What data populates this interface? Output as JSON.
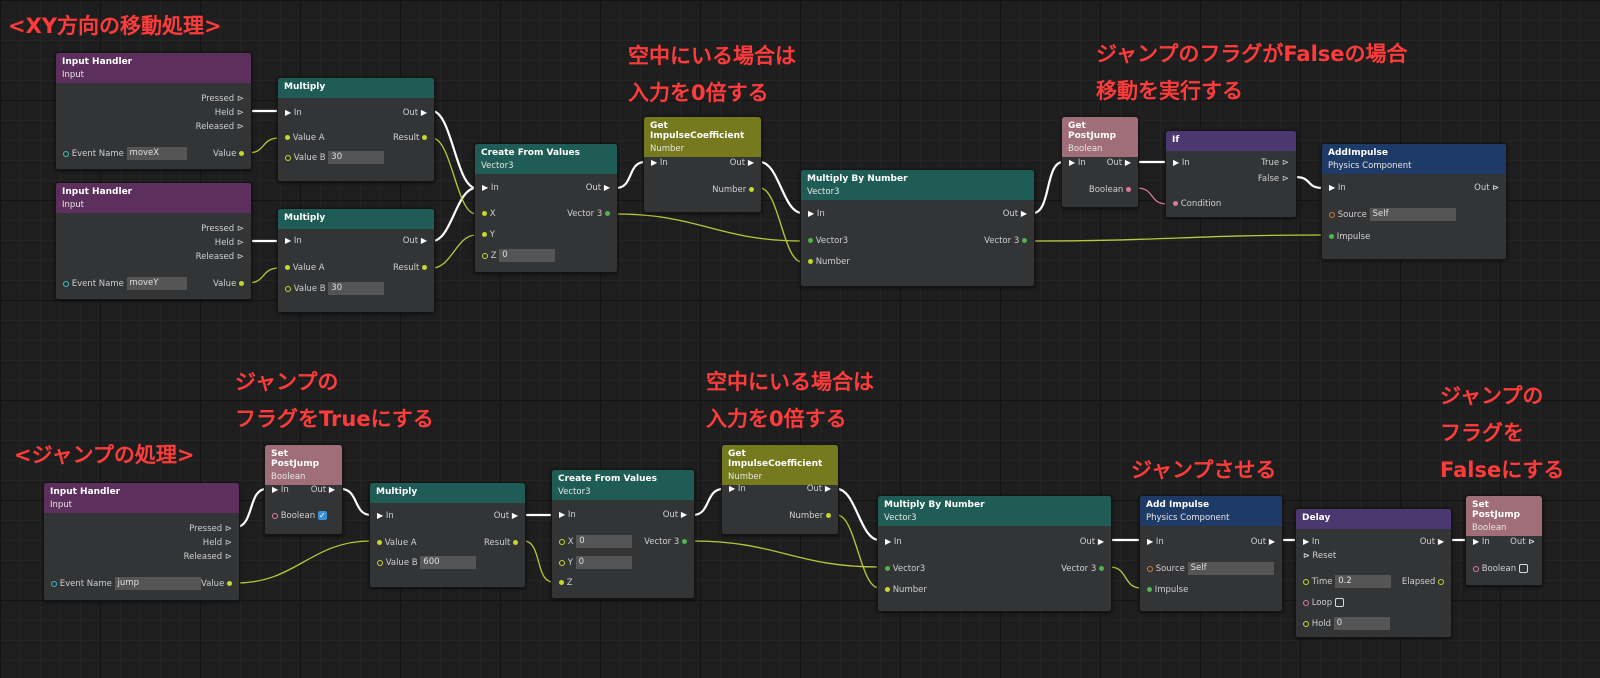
{
  "notes": {
    "xy_heading": "<XY方向の移動処理>",
    "air1": "空中にいる場合は\n入力を0倍する",
    "postjump_false": "ジャンプのフラグがFalseの場合\n移動を実行する",
    "flag_true": "ジャンプの\nフラグをTrueにする",
    "jump_heading": "<ジャンプの処理>",
    "air2": "空中にいる場合は\n入力を0倍する",
    "do_jump": "ジャンプさせる",
    "flag_false": "ジャンプの\nフラグを\nFalseにする"
  },
  "labels": {
    "input_handler": "Input Handler",
    "input": "Input",
    "pressed": "Pressed ⊳",
    "held": "Held ⊳",
    "released": "Released ⊳",
    "event_name": "Event Name",
    "value": "Value",
    "multiply": "Multiply",
    "in": "In",
    "out": "Out",
    "value_a": "Value A",
    "value_b": "Value B",
    "result": "Result",
    "create_from_values": "Create From Values",
    "vector3": "Vector3",
    "x": "X",
    "y": "Y",
    "z": "Z",
    "vector_3": "Vector 3",
    "get_impulse_coefficient": "Get ImpulseCoefficient",
    "number_type": "Number",
    "number": "Number",
    "multiply_by_number": "Multiply By Number",
    "get_postjump": "Get PostJump",
    "set_postjump": "Set PostJump",
    "boolean": "Boolean",
    "if": "If",
    "true": "True ⊳",
    "false": "False ⊳",
    "condition": "Condition",
    "add_impulse_1": "AddImpulse",
    "add_impulse_2": "Add Impulse",
    "physics_component": "Physics Component",
    "source": "Source",
    "impulse": "Impulse",
    "delay": "Delay",
    "reset": "Reset",
    "time": "Time",
    "loop": "Loop",
    "hold": "Hold",
    "elapsed": "Elapsed"
  },
  "values": {
    "event_movex": "moveX",
    "event_movey": "moveY",
    "event_jump": "jump",
    "mult_b_30": "30",
    "mult_b_600": "600",
    "z_0": "0",
    "x_0": "0",
    "y_0": "0",
    "source_self": "Self",
    "time": "0.2",
    "hold": "0"
  },
  "colors": {
    "input_handler": "#5c2f5c",
    "multiply": "#1f5c55",
    "impulse_coef": "#767a1e",
    "postjump": "#a06e79",
    "if_delay": "#4b3870",
    "add_impulse": "#1e3a66",
    "exec_wire": "#ffffff",
    "data_wire": "#b9c93a",
    "bool_wire": "#d87b9a",
    "note": "#ff3b3b"
  }
}
